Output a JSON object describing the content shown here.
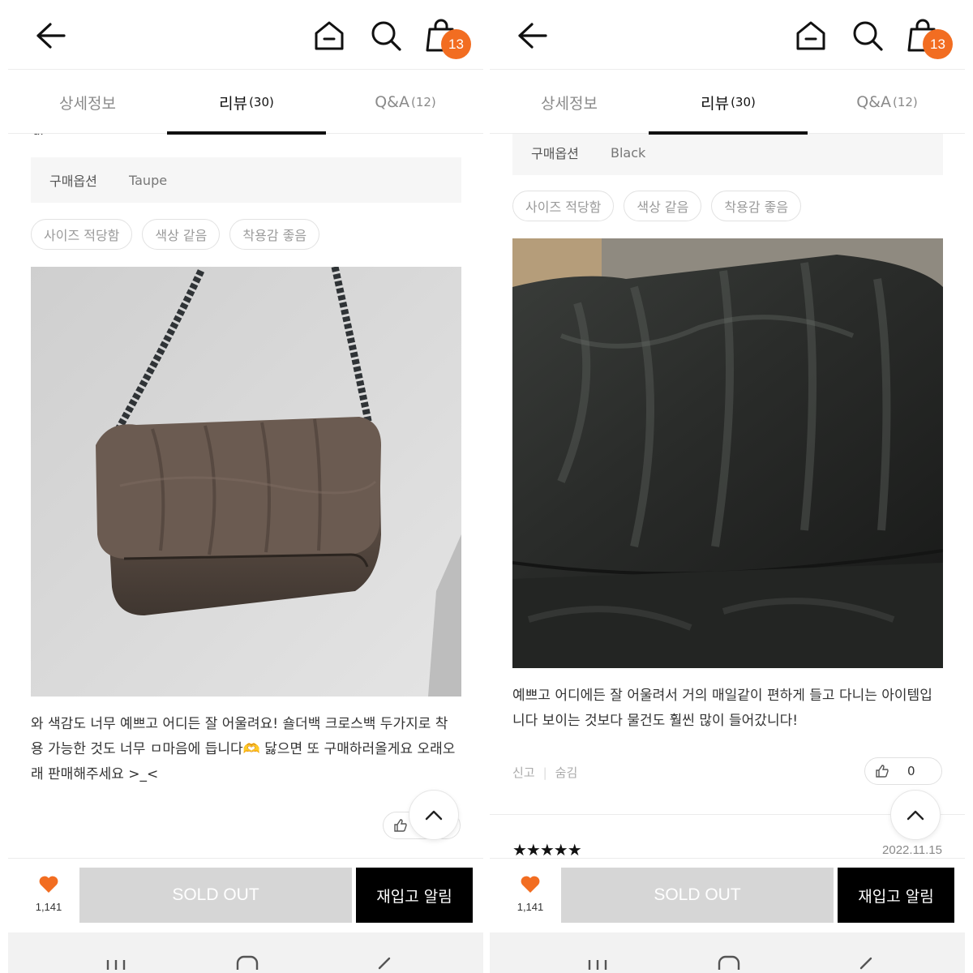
{
  "header": {
    "icons": [
      "back-arrow-icon",
      "home-icon",
      "search-icon",
      "shopping-bag-icon"
    ],
    "cart_badge": "13"
  },
  "tabs": [
    {
      "label": "상세정보",
      "count": ""
    },
    {
      "label": "리뷰",
      "count": "(30)"
    },
    {
      "label": "Q&A",
      "count": "(12)"
    }
  ],
  "accent_color": "#f26d21",
  "left": {
    "cutoff_text": "dl",
    "option_label": "구매옵션",
    "option_value": "Taupe",
    "chips": [
      "사이즈 적당함",
      "색상 같음",
      "착용감 좋음"
    ],
    "review_text": "와 색감도 너무 예쁘고 어디든 잘 어울려요! 숄더백 크로스백 두가지로 착용 가능한 것도 너무 ㅁ마음에 듭니다🫶 닳으면 또 구매하러올게요 오래오래 판매해주세요 >_<"
  },
  "right": {
    "option_label": "구매옵션",
    "option_value": "Black",
    "chips": [
      "사이즈 적당함",
      "색상 같음",
      "착용감 좋음"
    ],
    "review_text": "예쁘고 어디에든 잘 어울려서 거의 매일같이 편하게 들고 다니는 아이템입니다 보이는 것보다 물건도 훨씬 많이 들어갔니다!",
    "report": "신고",
    "hide": "숨김",
    "like_count": "0",
    "next_stars": "★★★★★",
    "next_date": "2022.11.15"
  },
  "bottom_bar": {
    "favorites": "1,141",
    "sold_out": "SOLD OUT",
    "restock": "재입고 알림"
  }
}
